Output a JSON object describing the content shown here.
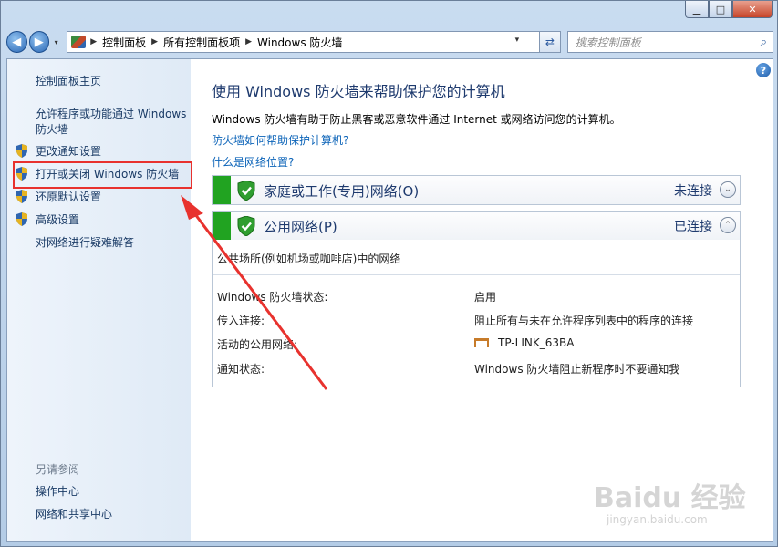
{
  "window": {
    "minimize": "▁",
    "maximize": "□",
    "close": "✕"
  },
  "nav": {
    "back_icon": "◀",
    "forward_icon": "▶",
    "dropdown_icon": "▾",
    "breadcrumb": [
      "控制面板",
      "所有控制面板项",
      "Windows 防火墙"
    ],
    "separator": "▶",
    "refresh_icon": "⇄",
    "search_placeholder": "搜索控制面板",
    "search_icon": "⌕"
  },
  "sidebar": {
    "home": "控制面板主页",
    "allow_program": "允许程序或功能通过 Windows 防火墙",
    "change_notify": "更改通知设置",
    "toggle_firewall": "打开或关闭 Windows 防火墙",
    "restore_defaults": "还原默认设置",
    "advanced": "高级设置",
    "troubleshoot": "对网络进行疑难解答",
    "see_also": "另请参阅",
    "action_center": "操作中心",
    "network_center": "网络和共享中心"
  },
  "main": {
    "help": "?",
    "title": "使用 Windows 防火墙来帮助保护您的计算机",
    "description": "Windows 防火墙有助于防止黑客或恶意软件通过 Internet 或网络访问您的计算机。",
    "link_how": "防火墙如何帮助保护计算机?",
    "link_location": "什么是网络位置?"
  },
  "home_network": {
    "title": "家庭或工作(专用)网络(O)",
    "status": "未连接",
    "toggle": "⌄"
  },
  "public_network": {
    "title": "公用网络(P)",
    "status": "已连接",
    "toggle": "⌃",
    "description": "公共场所(例如机场或咖啡店)中的网络",
    "rows": [
      {
        "label": "Windows 防火墙状态:",
        "value": "启用"
      },
      {
        "label": "传入连接:",
        "value": "阻止所有与未在允许程序列表中的程序的连接"
      },
      {
        "label": "活动的公用网络:",
        "value": "TP-LINK_63BA"
      },
      {
        "label": "通知状态:",
        "value": "Windows 防火墙阻止新程序时不要通知我"
      }
    ]
  },
  "colors": {
    "accent_green": "#21a321",
    "link_blue": "#0b63b8",
    "annotation_red": "#e8322e"
  },
  "watermark": {
    "brand": "Baidu 经验",
    "url": "jingyan.baidu.com"
  }
}
